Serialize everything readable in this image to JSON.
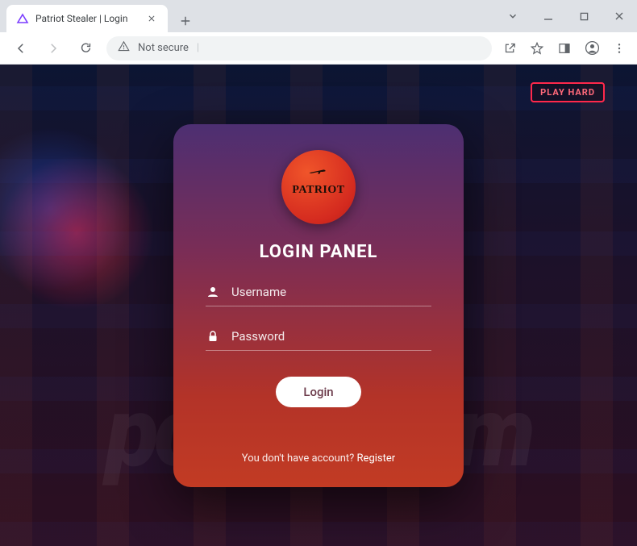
{
  "browser": {
    "tab_title": "Patriot Stealer | Login",
    "address_label": "Not secure",
    "address_divider": "|"
  },
  "background": {
    "badge": "PLAY HARD",
    "watermark": "pcrisk.com"
  },
  "login": {
    "brand": "PATRIOT",
    "title": "LOGIN PANEL",
    "username_placeholder": "Username",
    "password_placeholder": "Password",
    "button_label": "Login",
    "no_account_text": "You don't have account? ",
    "register_label": "Register"
  }
}
